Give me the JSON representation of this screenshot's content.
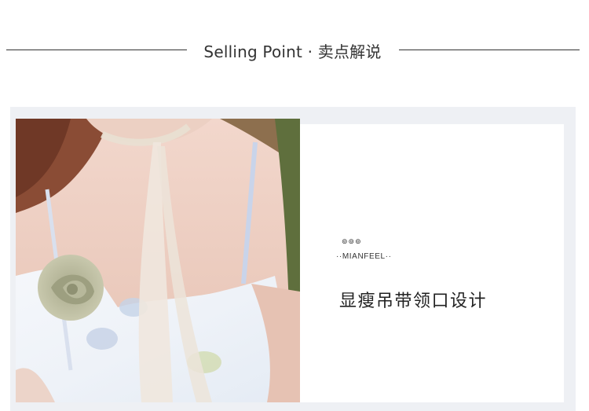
{
  "header": {
    "title": "Selling Point · 卖点解说"
  },
  "feature": {
    "deco": "⊚⊚⊚",
    "brand": "··MIANFEEL··",
    "headline": "显瘦吊带领口设计"
  },
  "photo": {
    "subject": "model wearing a white camisole dress with a fabric rosette and a long neck ribbon"
  },
  "colors": {
    "panel_background": "#eef0f4",
    "card_background": "#ffffff",
    "text": "#222222",
    "rule": "#333333"
  }
}
